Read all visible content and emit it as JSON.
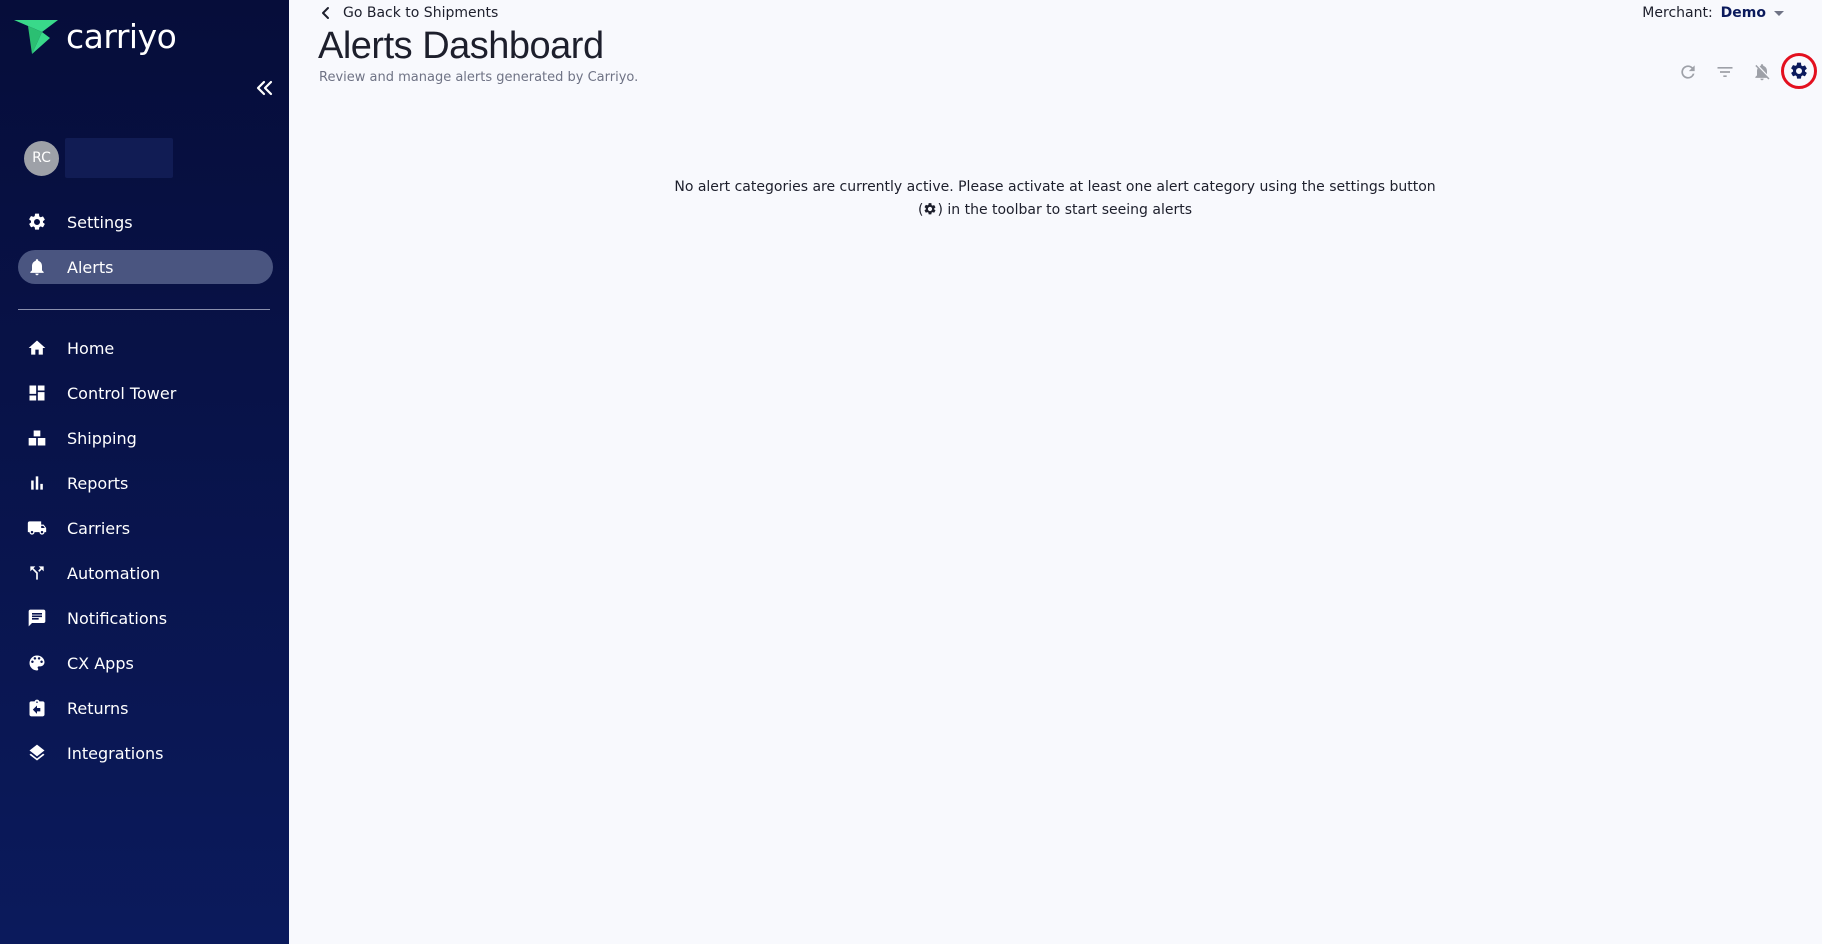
{
  "brand": {
    "name": "carriyo",
    "accent": "#39d98a"
  },
  "user": {
    "initials": "RC"
  },
  "sidebar": {
    "top_items": [
      {
        "label": "Settings",
        "icon": "gear-icon"
      },
      {
        "label": "Alerts",
        "icon": "bell-icon",
        "active": true
      }
    ],
    "items": [
      {
        "label": "Home",
        "icon": "home-icon"
      },
      {
        "label": "Control Tower",
        "icon": "dashboard-icon"
      },
      {
        "label": "Shipping",
        "icon": "boxes-icon"
      },
      {
        "label": "Reports",
        "icon": "bar-chart-icon"
      },
      {
        "label": "Carriers",
        "icon": "truck-icon"
      },
      {
        "label": "Automation",
        "icon": "fork-icon"
      },
      {
        "label": "Notifications",
        "icon": "message-icon"
      },
      {
        "label": "CX Apps",
        "icon": "palette-icon"
      },
      {
        "label": "Returns",
        "icon": "return-box-icon"
      },
      {
        "label": "Integrations",
        "icon": "layers-icon"
      }
    ]
  },
  "header": {
    "back_label": "Go Back to Shipments",
    "title": "Alerts Dashboard",
    "subtitle": "Review and manage alerts generated by Carriyo.",
    "merchant_label": "Merchant:",
    "merchant_value": "Demo"
  },
  "toolbar": {
    "buttons": [
      "refresh-icon",
      "filter-icon",
      "bell-off-icon",
      "settings-icon"
    ],
    "highlight_color": "#e3101f"
  },
  "empty_state": {
    "line1": "No alert categories are currently active. Please activate at least one alert category using the settings button",
    "line2_pre": "(",
    "line2_post": ") in the toolbar to start seeing alerts"
  }
}
